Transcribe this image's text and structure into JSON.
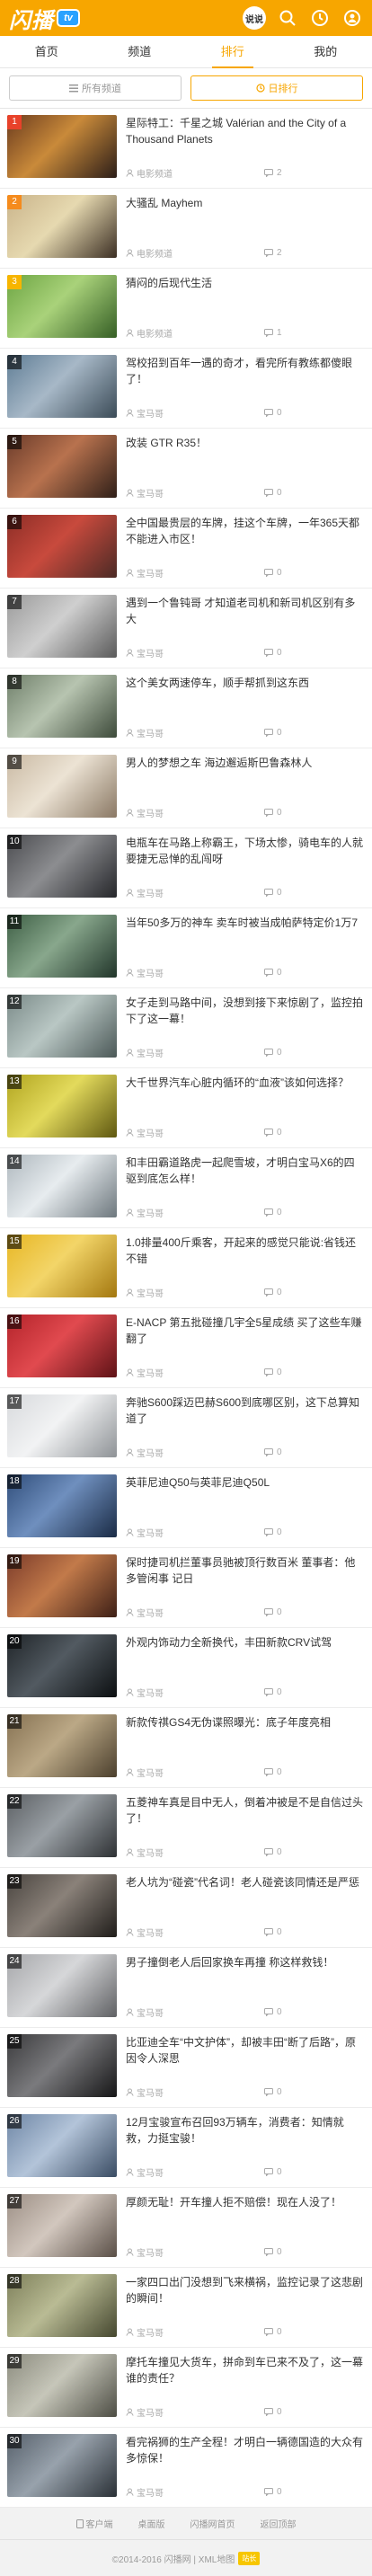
{
  "header": {
    "logo_text": "闪播",
    "logo_tv": "tv",
    "avatar_label": "说说"
  },
  "nav": [
    {
      "label": "首页"
    },
    {
      "label": "频道"
    },
    {
      "label": "排行"
    },
    {
      "label": "我的"
    }
  ],
  "filters": {
    "all_channels": "所有频道",
    "daily_rank": "日排行"
  },
  "items": [
    {
      "rank": "1",
      "title": "星际特工：千星之城 Valérian and the City of a Thousand Planets",
      "source": "电影频道",
      "comments": "2",
      "colors": [
        "#6b3b1e",
        "#c98a3a",
        "#2b1d18"
      ]
    },
    {
      "rank": "2",
      "title": "大骚乱 Mayhem",
      "source": "电影频道",
      "comments": "2",
      "colors": [
        "#c9b38a",
        "#e6d9b0",
        "#3b2e23"
      ]
    },
    {
      "rank": "3",
      "title": "猜闷的后现代生活",
      "source": "电影频道",
      "comments": "1",
      "colors": [
        "#6da543",
        "#a9d27a",
        "#355e25"
      ]
    },
    {
      "rank": "4",
      "title": "驾校招到百年一遇的奇才，看完所有教练都傻眼了！",
      "source": "宝马哥",
      "comments": "0",
      "colors": [
        "#5f7d95",
        "#a7b8c7",
        "#3b4b57"
      ]
    },
    {
      "rank": "5",
      "title": "改装 GTR R35！",
      "source": "宝马哥",
      "comments": "0",
      "colors": [
        "#6a3b2a",
        "#b8724e",
        "#2f1f18"
      ]
    },
    {
      "rank": "6",
      "title": "全中国最贵层的车牌，挂这个车牌，一年365天都不能进入市区！",
      "source": "宝马哥",
      "comments": "0",
      "colors": [
        "#8c2d26",
        "#c84a3d",
        "#4b2a25"
      ]
    },
    {
      "rank": "7",
      "title": "遇到一个鲁钝哥 才知道老司机和新司机区别有多大",
      "source": "宝马哥",
      "comments": "0",
      "colors": [
        "#9a9a9a",
        "#cfcfcf",
        "#5a5a5a"
      ]
    },
    {
      "rank": "8",
      "title": "这个美女两速停车，顺手帮抓到这东西",
      "source": "宝马哥",
      "comments": "0",
      "colors": [
        "#6f7f6a",
        "#b7c4b0",
        "#3d4a3a"
      ]
    },
    {
      "rank": "9",
      "title": "男人的梦想之车 海边邂逅斯巴鲁森林人",
      "source": "宝马哥",
      "comments": "0",
      "colors": [
        "#c9b9a3",
        "#ece3d4",
        "#8a7864"
      ]
    },
    {
      "rank": "10",
      "title": "电瓶车在马路上称霸王，下场太惨，骑电车的人就要捷无忌惮的乱闯呀",
      "source": "宝马哥",
      "comments": "0",
      "colors": [
        "#4a4b4f",
        "#8c8d90",
        "#25262a"
      ]
    },
    {
      "rank": "11",
      "title": "当年50多万的神车 卖车时被当成帕萨特定价1万7",
      "source": "宝马哥",
      "comments": "0",
      "colors": [
        "#3d5e44",
        "#88a78c",
        "#21352a"
      ]
    },
    {
      "rank": "12",
      "title": "女子走到马路中间，没想到接下来惊剧了，监控拍下了这一幕！",
      "source": "宝马哥",
      "comments": "0",
      "colors": [
        "#7a8a88",
        "#b9c7c4",
        "#4b5857"
      ]
    },
    {
      "rank": "13",
      "title": "大千世界汽车心脏内循环的“血液”该如何选择？",
      "source": "宝马哥",
      "comments": "0",
      "colors": [
        "#b0a41f",
        "#e3da5c",
        "#5e5710"
      ]
    },
    {
      "rank": "14",
      "title": "和丰田霸道路虎一起爬雪坡，才明白宝马X6的四驱到底怎么样！",
      "source": "宝马哥",
      "comments": "0",
      "colors": [
        "#aeb7bd",
        "#e7ecef",
        "#6d777d"
      ]
    },
    {
      "rank": "15",
      "title": "1.0排量400斤乘客，开起来的感觉只能说:省钱还不错",
      "source": "宝马哥",
      "comments": "0",
      "colors": [
        "#e7b623",
        "#f3d568",
        "#a3770f"
      ]
    },
    {
      "rank": "16",
      "title": "E-NACP 第五批碰撞几宇全5星成绩 买了这些车赚翻了",
      "source": "宝马哥",
      "comments": "0",
      "colors": [
        "#b3232a",
        "#e14a4f",
        "#5e1216"
      ]
    },
    {
      "rank": "17",
      "title": "奔驰S600踩迈巴赫S600到底哪区别，这下总算知道了",
      "source": "宝马哥",
      "comments": "0",
      "colors": [
        "#d7d9dc",
        "#f2f3f4",
        "#8e9296"
      ]
    },
    {
      "rank": "18",
      "title": "英菲尼迪Q50与英菲尼迪Q50L",
      "source": "宝马哥",
      "comments": "0",
      "colors": [
        "#2f4d7a",
        "#6f8fbe",
        "#1a2b45"
      ]
    },
    {
      "rank": "19",
      "title": "保时捷司机拦董事员驰被顶行数百米 董事者：他多管闲事 记日",
      "source": "宝马哥",
      "comments": "0",
      "colors": [
        "#7b3b2a",
        "#c27a4a",
        "#3d1f16"
      ]
    },
    {
      "rank": "20",
      "title": "外观内饰动力全新换代，丰田新款CRV试驾",
      "source": "宝马哥",
      "comments": "0",
      "colors": [
        "#1f2428",
        "#525a61",
        "#0c0f11"
      ]
    },
    {
      "rank": "21",
      "title": "新款传祺GS4无伪谍照曝光：底子年度亮相",
      "source": "宝马哥",
      "comments": "0",
      "colors": [
        "#857152",
        "#bba886",
        "#4b3f2d"
      ]
    },
    {
      "rank": "22",
      "title": "五菱神车真是目中无人，倒着冲被是不是自信过头了！",
      "source": "宝马哥",
      "comments": "0",
      "colors": [
        "#5b5f63",
        "#9aa0a5",
        "#2e3134"
      ]
    },
    {
      "rank": "23",
      "title": "老人坑为“碰瓷”代名词！老人碰瓷该同情还是严惩",
      "source": "宝马哥",
      "comments": "0",
      "colors": [
        "#49443f",
        "#8a8179",
        "#201d1a"
      ]
    },
    {
      "rank": "24",
      "title": "男子撞倒老人后回家换车再撞 称这样救钱！",
      "source": "宝马哥",
      "comments": "0",
      "colors": [
        "#a5a6a9",
        "#d6d7d9",
        "#5f6063"
      ]
    },
    {
      "rank": "25",
      "title": "比亚迪全车“中文护体”，却被丰田“断了后路”，原因令人深思",
      "source": "宝马哥",
      "comments": "0",
      "colors": [
        "#3a3a3c",
        "#7a7a7d",
        "#161617"
      ]
    },
    {
      "rank": "26",
      "title": "12月宝骏宣布召回93万辆车，消费者：知情就救，力挺宝骏！",
      "source": "宝马哥",
      "comments": "0",
      "colors": [
        "#6e86a5",
        "#b3c4d9",
        "#3a4c63"
      ]
    },
    {
      "rank": "27",
      "title": "厚颜无耻！开车撞人拒不赔偿！现在人没了！",
      "source": "宝马哥",
      "comments": "0",
      "colors": [
        "#9b8e84",
        "#d2c7be",
        "#5a4f47"
      ]
    },
    {
      "rank": "28",
      "title": "一家四口出门没想到飞来横祸，监控记录了这悲剧的瞬间！",
      "source": "宝马哥",
      "comments": "0",
      "colors": [
        "#7d7f5a",
        "#b9bb94",
        "#45472f"
      ]
    },
    {
      "rank": "29",
      "title": "摩托车撞见大货车，拼命到车已来不及了，这一幕谁的责任？",
      "source": "宝马哥",
      "comments": "0",
      "colors": [
        "#8b8b7e",
        "#c6c6b9",
        "#4d4d44"
      ]
    },
    {
      "rank": "30",
      "title": "看完祸狮的生产全程！才明白一辆德国造的大众有多惊保！",
      "source": "宝马哥",
      "comments": "0",
      "colors": [
        "#56606b",
        "#98a2ac",
        "#2a3036"
      ]
    }
  ],
  "footer": {
    "links": [
      "客户端",
      "桌面版",
      "闪播网首页",
      "返回顶部"
    ],
    "copyright": "©2014-2016 闪播网 | XML地图",
    "badge": "站长"
  },
  "colors": {
    "brand": "#f7a600",
    "rank1": "#e8422a",
    "rank2": "#f58b1d",
    "rank3": "#f7b500"
  }
}
